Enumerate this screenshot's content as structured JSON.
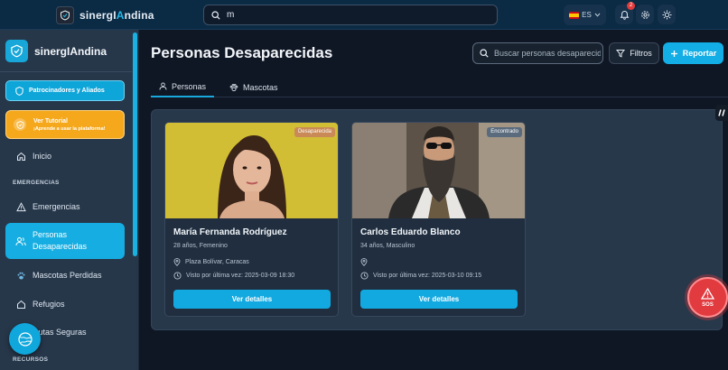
{
  "topbar": {
    "brand_prefix": "sinergI",
    "brand_mid": "A",
    "brand_suffix": "ndina",
    "search_value": "m",
    "lang_code": "ES",
    "notif_count": "2"
  },
  "sidebar": {
    "brand": "sinergIAndina",
    "sponsors_label": "Patrocinadores y Aliados",
    "tutorial_title": "Ver Tutorial",
    "tutorial_sub": "¡Aprende a usar la plataforma!",
    "home": "Inicio",
    "section_emergencias": "EMERGENCIAS",
    "emergencias": "Emergencias",
    "personas_line1": "Personas",
    "personas_line2": "Desaparecidas",
    "mascotas": "Mascotas Perdidas",
    "refugios": "Refugios",
    "rutas": "Rutas Seguras",
    "section_recursos": "RECURSOS"
  },
  "main": {
    "title": "Personas Desaparecidas",
    "search_placeholder": "Buscar personas desaparecidas...",
    "filters_label": "Filtros",
    "report_label": "Reportar",
    "tabs": [
      {
        "label": "Personas"
      },
      {
        "label": "Mascotas"
      }
    ],
    "cards": [
      {
        "status": "Desaparecida",
        "name": "María Fernanda Rodríguez",
        "meta": "28 años, Femenino",
        "location": "Plaza Bolívar, Caracas",
        "last_seen": "Visto por última vez: 2025-03-09 18:30",
        "button": "Ver detalles"
      },
      {
        "status": "Encontrado",
        "name": "Carlos Eduardo Blanco",
        "meta": "34 años, Masculino",
        "location": "",
        "last_seen": "Visto por última vez: 2025-03-10 09:15",
        "button": "Ver detalles"
      }
    ]
  },
  "sos_label": "SOS",
  "colors": {
    "accent": "#12aee5",
    "tutorial": "#f6a81c",
    "sos": "#e13a3f",
    "status_missing": "#c98a58",
    "status_found": "#5a6b7d"
  }
}
